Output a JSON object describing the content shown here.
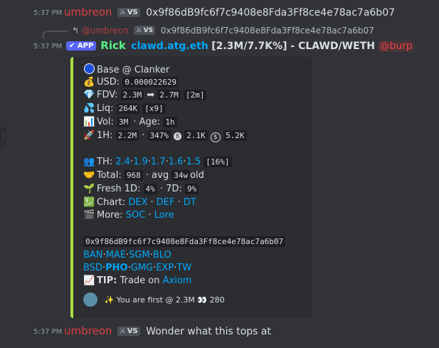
{
  "messages": [
    {
      "time": "5:37 PM",
      "author": "umbreon",
      "badge": "VS",
      "text": "0x9f86dB9fc6f7c9408e8Fda3Ff8ce4e78ac7a6b07"
    },
    {
      "reply": {
        "mention": "@umbreon",
        "badge": "VS",
        "text": "0x9f86dB9fc6f7c9408e8Fda3Ff8ce4e78ac7a6b07"
      },
      "time": "5:37 PM",
      "app_badge": "APP",
      "author": "Rick",
      "title_link": "clawd.atg.eth",
      "title_rest": "[2.3M/7.7K%] - CLAWD/WETH",
      "mention": "@burp",
      "embed": {
        "chain_line": "Base @ Clanker",
        "usd_label": "USD:",
        "usd_value": "0.000022629",
        "fdv_label": "FDV:",
        "fdv_from": "2.3M",
        "fdv_arrow": "➡",
        "fdv_to": "2.7M",
        "fdv_tf": "[2m]",
        "liq_label": "Liq:",
        "liq_value": "264K",
        "liq_mult": "[x9]",
        "vol_label": "Vol:",
        "vol_value": "3M",
        "age_label": "· Age:",
        "age_value": "1h",
        "h1_label": "1H:",
        "h1_vol": "2.2M",
        "dot": "·",
        "h1_pct": "347%",
        "h1_buys": "2.1K",
        "h1_sells": "5.2K",
        "th_label": "TH:",
        "th_values": [
          "2.4",
          "1.9",
          "1.7",
          "1.6",
          "1.5"
        ],
        "th_total": "[16%]",
        "total_label": "Total:",
        "total_value": "968",
        "avg_label": "· avg",
        "avg_value": "34w",
        "old_label": "old",
        "fresh_label": "Fresh 1D:",
        "fresh_1d": "4%",
        "fresh_7d_label": "· 7D:",
        "fresh_7d": "9%",
        "chart_label": "Chart:",
        "chart_links": [
          "DEX",
          "DEF",
          "DT"
        ],
        "more_label": "More:",
        "more_links": [
          "SOC",
          "Lore"
        ],
        "address": "0x9f86dB9fc6f7c9408e8Fda3Ff8ce4e78ac7a6b07",
        "links_row1": [
          "BAN",
          "MAE",
          "SGM",
          "BLO"
        ],
        "links_row2": [
          "BSD",
          "PHO",
          "GMG",
          "EXP",
          "TW"
        ],
        "tip_label": "TIP:",
        "tip_text": "Trade on",
        "tip_link": "Axiom",
        "footer_text": "You are first @ 2.3M",
        "footer_count": "280"
      }
    },
    {
      "time": "5:37 PM",
      "author": "umbreon",
      "badge": "VS",
      "text": "Wonder what this tops at"
    }
  ],
  "colors": {
    "background": "#313338",
    "embed_bg": "#2b2d31",
    "embed_accent": "#a8e03d",
    "link": "#00a8fc",
    "author_red": "#e03e3e",
    "bot_green": "#57f287"
  }
}
